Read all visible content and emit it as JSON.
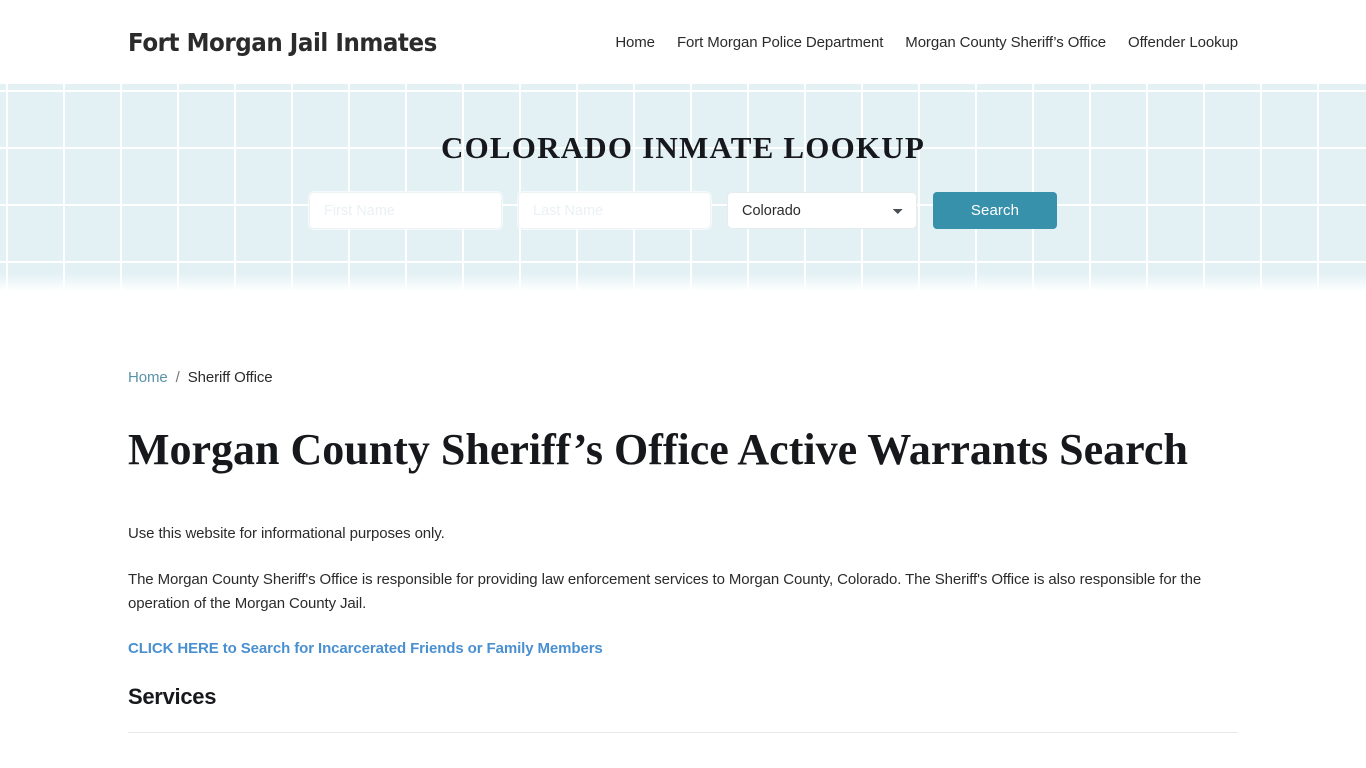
{
  "header": {
    "brand": "Fort Morgan Jail Inmates",
    "nav": [
      {
        "label": "Home"
      },
      {
        "label": "Fort Morgan Police Department"
      },
      {
        "label": "Morgan County Sheriff’s Office"
      },
      {
        "label": "Offender Lookup"
      }
    ]
  },
  "hero": {
    "title": "COLORADO INMATE LOOKUP",
    "accent_color": "#3791ab",
    "background_color": "#e3f1f5",
    "form": {
      "first_name": {
        "value": "",
        "placeholder": "First Name"
      },
      "last_name": {
        "value": "",
        "placeholder": "Last Name"
      },
      "state": {
        "selected": "Colorado",
        "options": [
          "Colorado"
        ]
      },
      "submit_label": "Search"
    }
  },
  "breadcrumb": {
    "home": "Home",
    "separator": "/",
    "current": "Sheriff Office",
    "link_color": "#5a93a8"
  },
  "main": {
    "page_title": "Morgan County Sheriff’s Office Active Warrants Search",
    "paragraph_1": "Use this website for informational purposes only.",
    "paragraph_2": "The Morgan County Sheriff's Office is responsible for providing law enforcement services to Morgan County, Colorado. The Sheriff's Office is also responsible for the operation of the Morgan County Jail.",
    "cta_label": "CLICK HERE to Search for Incarcerated Friends or Family Members",
    "cta_color": "#4a90d0",
    "section_title": "Services"
  }
}
